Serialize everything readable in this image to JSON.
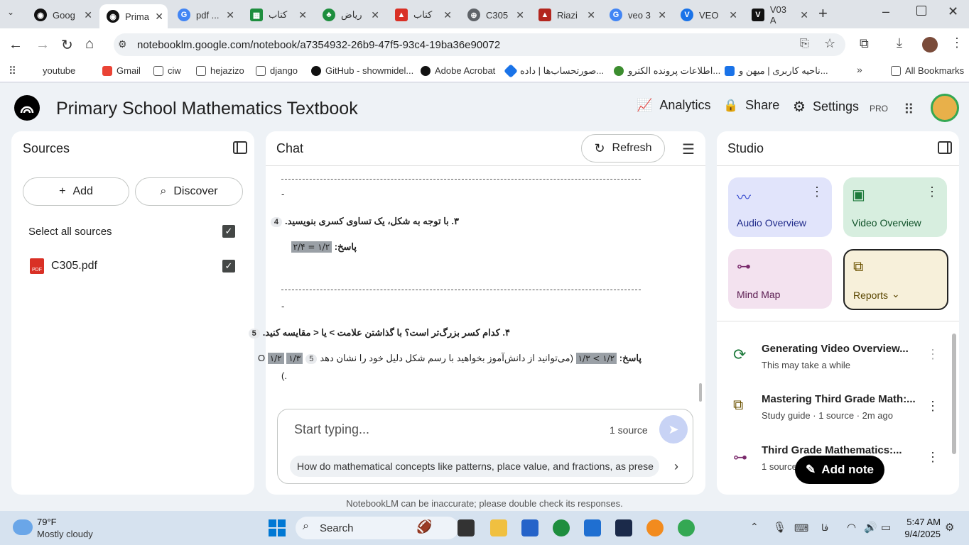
{
  "browser": {
    "tabs": [
      {
        "label": "Goog"
      },
      {
        "label": "Prima"
      },
      {
        "label": "pdf ..."
      },
      {
        "label": "کتاب"
      },
      {
        "label": "ریاض"
      },
      {
        "label": "کتاب"
      },
      {
        "label": "C305"
      },
      {
        "label": "Riazi"
      },
      {
        "label": "veo 3"
      },
      {
        "label": "VEO"
      },
      {
        "label": "V03 A"
      }
    ],
    "url": "notebooklm.google.com/notebook/a7354932-26b9-47f5-93c4-19ba36e90072",
    "bookmarks": [
      "youtube",
      "Gmail",
      "ciw",
      "hejazizo",
      "django",
      "GitHub - showmidel...",
      "Adobe Acrobat",
      "صورتحساب‌ها | داده...",
      "اطلاعات پرونده الکترو...",
      "ناحیه کاربری | میهن و...",
      "All Bookmarks"
    ]
  },
  "app": {
    "title": "Primary School Mathematics Textbook",
    "analytics_label": "Analytics",
    "share_label": "Share",
    "settings_label": "Settings",
    "pro_badge": "PRO"
  },
  "sources": {
    "heading": "Sources",
    "add_label": "Add",
    "discover_label": "Discover",
    "select_all_label": "Select all sources",
    "items": [
      {
        "name": "C305.pdf"
      }
    ]
  },
  "chat": {
    "heading": "Chat",
    "refresh_label": "Refresh",
    "dash_short": "-",
    "q4_text": "۳. با توجه به شکل، یک تساوی کسری بنویسید.",
    "q4_cite": "4",
    "answer_label": "پاسخ:",
    "q4_answer": "۱/۲ = ۲/۴",
    "q5_text": "۴. کدام کسر بزرگ‌تر است؟ با گذاشتن علامت > یا < مقایسه کنید.",
    "q5_cite": "5",
    "q5_answer_expr": "۱/۲ > ۱/۳",
    "q5_answer_rest": "(می‌توانید از دانش‌آموز بخواهید با رسم شکل دلیل خود را نشان دهد",
    "q5_cite2": "5",
    "q5_tail_a": "۱/۳",
    "q5_circle": "O",
    "q5_tail_b": "۱/۲",
    "q5_close": "(.",
    "input_placeholder": "Start typing...",
    "source_count": "1 source",
    "suggestion": "How do mathematical concepts like patterns, place value, and fractions, as prese"
  },
  "studio": {
    "heading": "Studio",
    "cards": [
      {
        "label": "Audio Overview",
        "color": "#e1e4fb"
      },
      {
        "label": "Video Overview",
        "color": "#d7eedf"
      },
      {
        "label": "Mind Map",
        "color": "#f3e2ef"
      },
      {
        "label": "Reports",
        "color": "#f7f0da"
      }
    ],
    "items": [
      {
        "title": "Generating Video Overview...",
        "subtitle": "This may take a while"
      },
      {
        "title": "Mastering Third Grade Math:...",
        "subtitle": "Study guide · 1 source · 2m ago"
      },
      {
        "title": "Third Grade Mathematics:...",
        "subtitle": "1 source"
      }
    ],
    "add_note_label": "Add note"
  },
  "footer_note": "NotebookLM can be inaccurate; please double check its responses.",
  "taskbar": {
    "weather_temp": "79°F",
    "weather_desc": "Mostly cloudy",
    "search_label": "Search",
    "lang": "فا",
    "time": "5:47 AM",
    "date": "9/4/2025"
  }
}
